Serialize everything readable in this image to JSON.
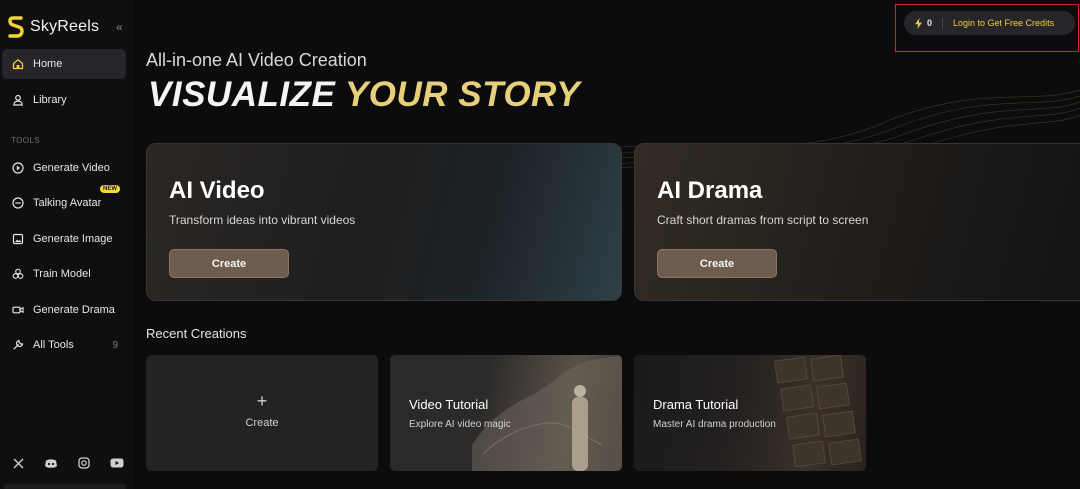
{
  "brand": {
    "name": "SkyReels"
  },
  "sidebar": {
    "collapse_glyph": "«",
    "section_label": "TOOLS",
    "items": [
      {
        "label": "Home",
        "icon": "home-icon",
        "active": true
      },
      {
        "label": "Library",
        "icon": "user-icon"
      },
      {
        "label": "Generate Video",
        "icon": "play-circle-icon"
      },
      {
        "label": "Talking Avatar",
        "icon": "face-icon",
        "badge": "NEW"
      },
      {
        "label": "Generate Image",
        "icon": "image-icon"
      },
      {
        "label": "Train Model",
        "icon": "cluster-icon"
      },
      {
        "label": "Generate Drama",
        "icon": "video-camera-icon"
      },
      {
        "label": "All Tools",
        "icon": "wrench-icon",
        "count": "9"
      }
    ],
    "socials": [
      "x-icon",
      "discord-icon",
      "instagram-icon",
      "youtube-icon"
    ]
  },
  "header": {
    "credits": "0",
    "login_text": "Login to Get Free Credits"
  },
  "hero": {
    "subtitle": "All-in-one AI Video Creation",
    "title_white": "VISUALIZE ",
    "title_gold": "YOUR STORY"
  },
  "cards": [
    {
      "title": "AI Video",
      "desc": "Transform ideas into vibrant videos",
      "button": "Create"
    },
    {
      "title": "AI Drama",
      "desc": "Craft short dramas from script to screen",
      "button": "Create"
    }
  ],
  "recent": {
    "label": "Recent Creations",
    "create_plus": "+",
    "create_label": "Create",
    "tiles": [
      {
        "title": "Video Tutorial",
        "desc": "Explore AI video magic"
      },
      {
        "title": "Drama Tutorial",
        "desc": "Master AI drama production"
      }
    ]
  },
  "colors": {
    "accent_gold": "#e8cf7a",
    "login_yellow": "#f2cc3a",
    "highlight_red": "#e0241b",
    "button_brown": "#6e5d4e"
  }
}
